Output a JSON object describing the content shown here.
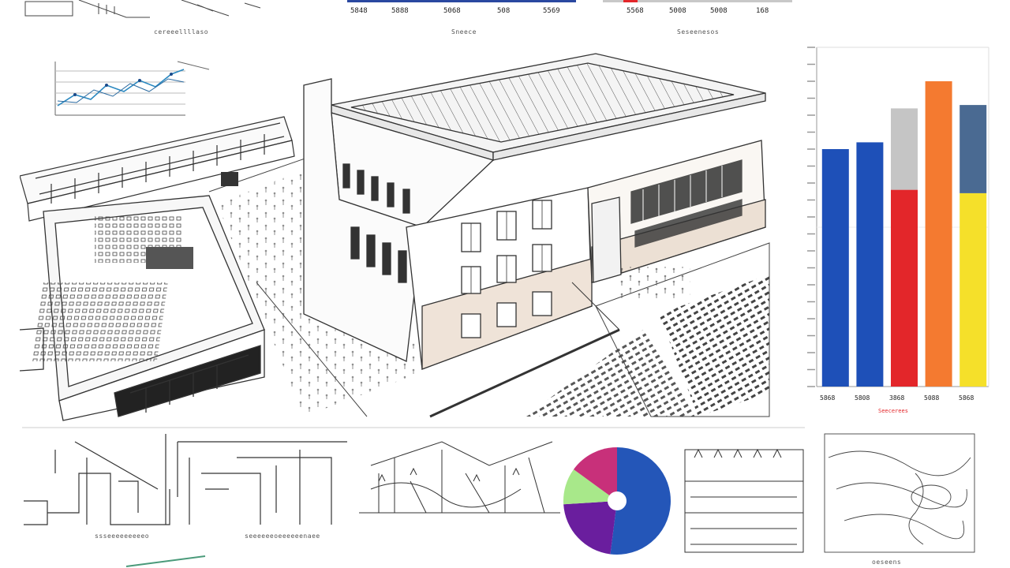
{
  "top_strip": {
    "caption_left": "cereeellllaso",
    "caption_mid": "Sneece",
    "caption_right": "Seseenesos",
    "mid_values": [
      "5848",
      "5888",
      "5068",
      "508",
      "5569"
    ],
    "right_values": [
      "5568",
      "5008",
      "5008",
      "168"
    ]
  },
  "main_chart": {
    "x_labels": [
      "5868",
      "5808",
      "3868",
      "5088",
      "5868"
    ],
    "caption": "Seecerees"
  },
  "chart_data": {
    "type": "bar",
    "categories": [
      "5868",
      "5808",
      "3868",
      "5088",
      "5868"
    ],
    "series": [
      {
        "values": [
          70,
          72,
          58,
          90,
          57
        ]
      },
      {
        "values": [
          0,
          0,
          24,
          0,
          26
        ]
      }
    ],
    "colors": [
      "#1e50b8",
      "#1e50b8",
      "#e3262a",
      "#f47a30",
      "#f5e02a"
    ],
    "stack_colors": [
      "#c5c5c5",
      "#4a6a92"
    ]
  },
  "pie": {
    "slices": [
      {
        "value": 52,
        "color": "#2456b8"
      },
      {
        "value": 22,
        "color": "#6a1e9e"
      },
      {
        "value": 11,
        "color": "#a8e88a"
      },
      {
        "value": 15,
        "color": "#c8307a"
      }
    ]
  },
  "bottom": {
    "caption_1": "ssseeeeeeeeeo",
    "caption_2": "seeeeeeoeeeeeenaee",
    "caption_3": "oeseens"
  }
}
